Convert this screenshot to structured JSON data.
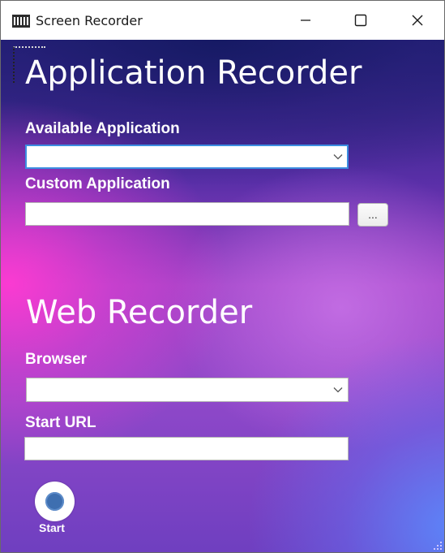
{
  "window": {
    "title": "Screen Recorder",
    "icon": "film-strip-icon",
    "controls": [
      "minimize-icon",
      "maximize-icon",
      "close-icon"
    ]
  },
  "application_recorder": {
    "title": "Application Recorder",
    "available_label": "Available Application",
    "available_value": "",
    "custom_label": "Custom Application",
    "custom_value": "",
    "browse_label": "..."
  },
  "web_recorder": {
    "title": "Web Recorder",
    "browser_label": "Browser",
    "browser_value": "",
    "url_label": "Start URL",
    "url_value": ""
  },
  "start": {
    "label": "Start",
    "icon": "record-icon"
  },
  "colors": {
    "accent_focus": "#3c8de0",
    "record_dot": "#3e6fb0",
    "label_text": "#ffffff"
  }
}
